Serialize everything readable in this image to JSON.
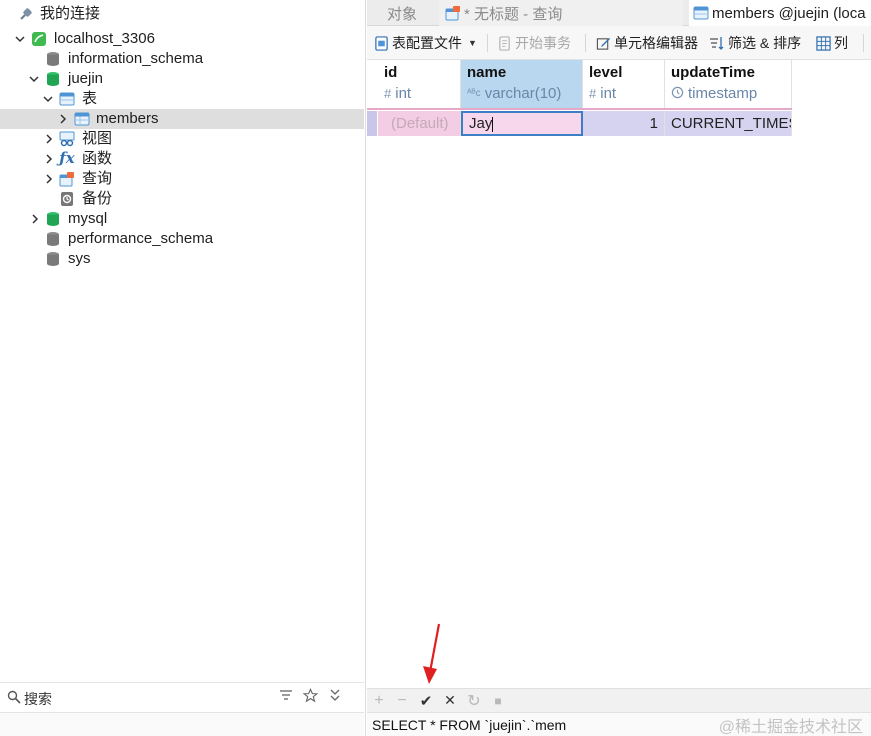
{
  "navigator": {
    "root_label": "我的连接",
    "nodes": [
      {
        "label": "localhost_3306",
        "level": 1,
        "expanded": true,
        "icon": "mysql-connection-icon"
      },
      {
        "label": "information_schema",
        "level": 2,
        "icon": "database-gray-icon"
      },
      {
        "label": "juejin",
        "level": 2,
        "expanded": true,
        "icon": "database-green-icon"
      },
      {
        "label": "表",
        "level": 3,
        "expanded": true,
        "icon": "tables-folder-icon"
      },
      {
        "label": "members",
        "level": 4,
        "selected": true,
        "icon": "table-icon"
      },
      {
        "label": "视图",
        "level": 3,
        "icon": "views-icon"
      },
      {
        "label": "函数",
        "level": 3,
        "icon": "function-icon"
      },
      {
        "label": "查询",
        "level": 3,
        "icon": "query-icon"
      },
      {
        "label": "备份",
        "level": 3,
        "icon": "backup-icon"
      },
      {
        "label": "mysql",
        "level": 2,
        "icon": "database-green-icon"
      },
      {
        "label": "performance_schema",
        "level": 2,
        "icon": "database-gray-icon"
      },
      {
        "label": "sys",
        "level": 2,
        "icon": "database-gray-icon"
      }
    ],
    "search_label": "搜索"
  },
  "tabs": [
    {
      "label": "对象",
      "active": false
    },
    {
      "label": "* 无标题 - 查询",
      "active": false
    },
    {
      "label": "members @juejin (loca",
      "active": true
    }
  ],
  "toolbar": {
    "table_config": "表配置文件",
    "begin_transaction": "开始事务",
    "cell_editor": "单元格编辑器",
    "filter_sort": "筛选 & 排序",
    "columns": "列"
  },
  "grid": {
    "columns": [
      {
        "name": "id",
        "type": "int",
        "type_icon": "#"
      },
      {
        "name": "name",
        "type": "varchar(10)",
        "type_icon": "ᴬᴮc"
      },
      {
        "name": "level",
        "type": "int",
        "type_icon": "#"
      },
      {
        "name": "updateTime",
        "type": "timestamp",
        "type_icon": "clock-icon"
      }
    ],
    "row": {
      "id": "(Default)",
      "name": "Jay",
      "level": "1",
      "updateTime": "CURRENT_TIMES"
    }
  },
  "footer": {
    "add": "+",
    "remove": "−",
    "apply": "✔",
    "discard": "✕",
    "refresh": "↻",
    "stop": "■"
  },
  "status": {
    "sql": "SELECT * FROM `juejin`.`mem",
    "watermark": "@稀土掘金技术社区"
  },
  "colors": {
    "selected_header": "#b9d7ef",
    "edited_row": "#d6d3f0",
    "edited_name_cell": "#f6d7ec",
    "annotation_arrow": "#e02020"
  }
}
